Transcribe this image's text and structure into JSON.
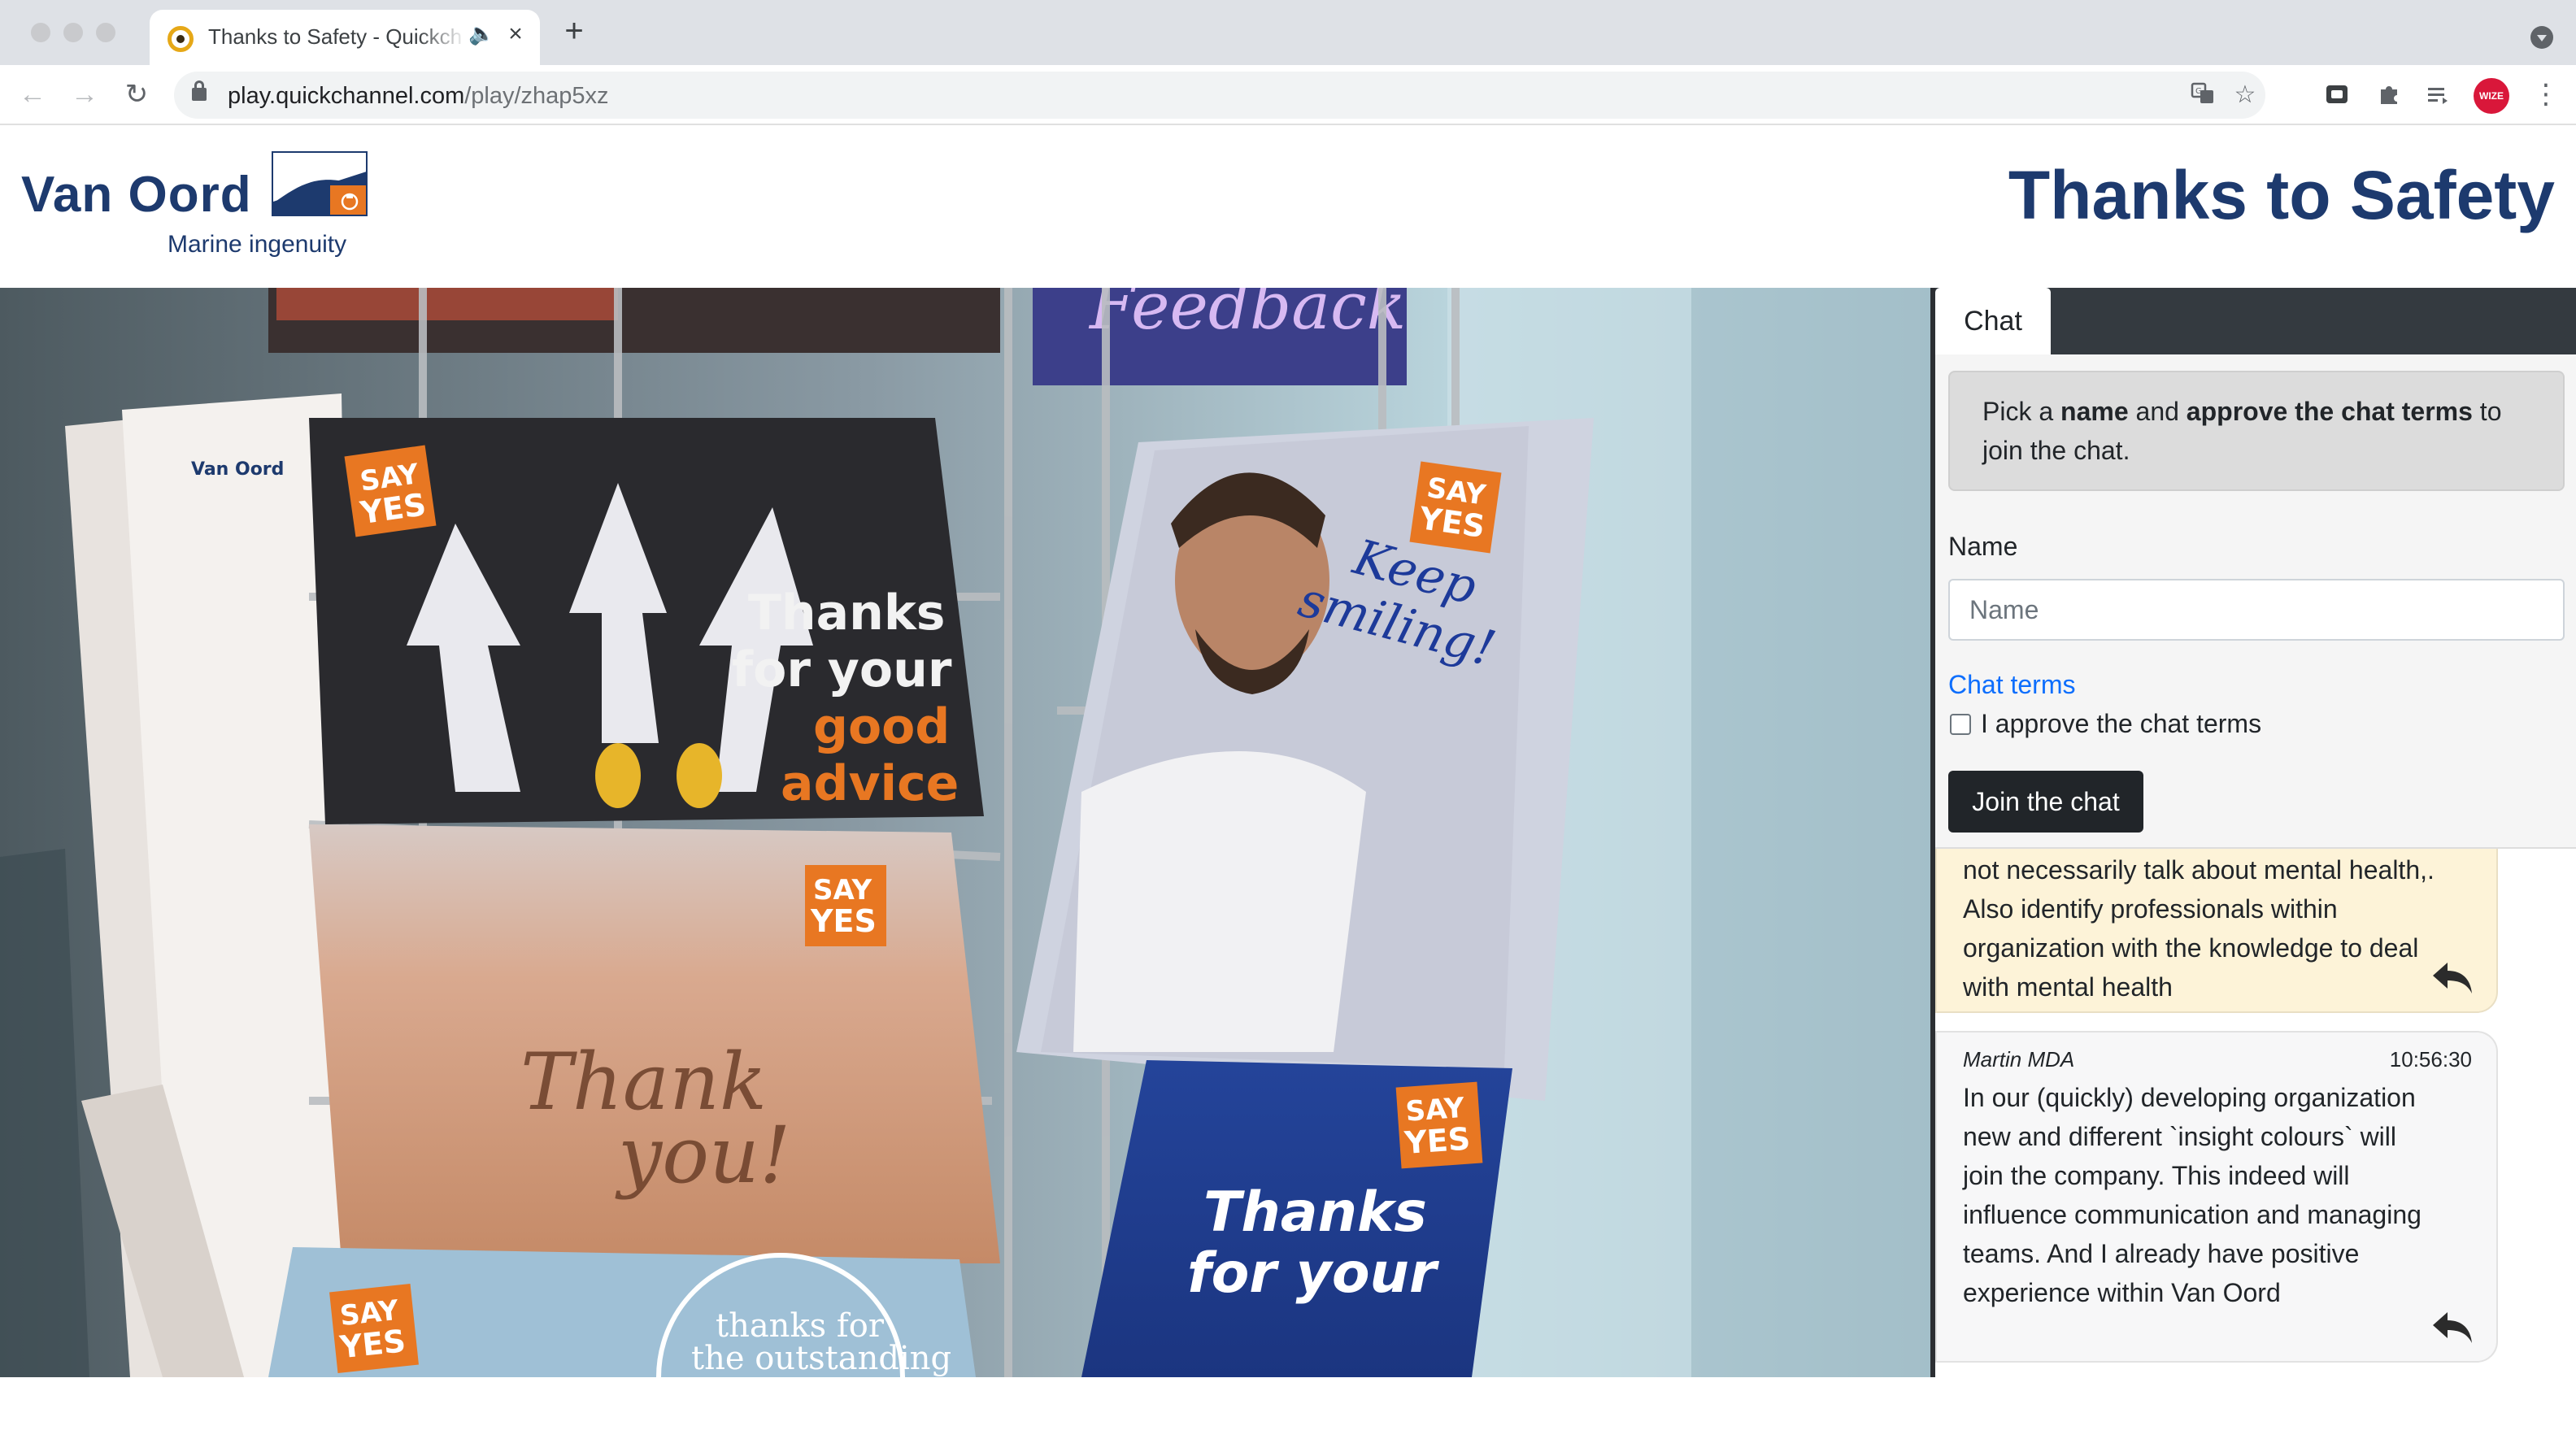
{
  "browser": {
    "tab": {
      "title": "Thanks to Safety - Quickchannel",
      "close": "×"
    },
    "new_tab": "+",
    "url": {
      "host": "play.quickchannel.com",
      "path": "/play/zhap5xz"
    },
    "nav": {
      "back": "←",
      "forward": "→",
      "reload": "↻"
    },
    "profile_label": "WIZE",
    "menu": "⋮"
  },
  "header": {
    "brand_name": "Van Oord",
    "brand_tagline": "Marine ingenuity",
    "title": "Thanks to Safety"
  },
  "chat": {
    "tab_label": "Chat",
    "notice": {
      "part1": "Pick a ",
      "bold1": "name",
      "part2": " and ",
      "bold2": "approve the chat terms",
      "part3": " to join the chat."
    },
    "name_label": "Name",
    "name_placeholder": "Name",
    "name_value": "",
    "terms_link": "Chat terms",
    "terms_checkbox_label": "I approve the chat terms",
    "terms_checked": false,
    "join_button": "Join the chat",
    "messages": [
      {
        "author": "",
        "time": "",
        "text": "not necessarily talk about mental health,. Also identify professionals within organization with the knowledge to deal with mental health",
        "highlighted": true
      },
      {
        "author": "Martin MDA",
        "time": "10:56:30",
        "text": "In our (quickly) developing organization new and different `insight colours` will join the company. This indeed will influence communication and managing teams. And I already have positive experience within Van Oord",
        "highlighted": false
      }
    ]
  },
  "video": {
    "card_texts": [
      "SAY YES",
      "Thanks for your good advice",
      "Keep smiling!",
      "Thank you!",
      "Thanks for your",
      "thanks for the outstanding",
      "Feedback"
    ]
  },
  "colors": {
    "brand": "#1d3a6e",
    "accent_orange": "#e87722",
    "link": "#0d6efd",
    "chat_tabbar": "#343a40",
    "message_highlight": "#fdf3d8"
  },
  "icons": [
    "favicon-icon",
    "audio-icon",
    "lock-icon",
    "translate-icon",
    "bookmark-star-icon",
    "extension-icon",
    "puzzle-icon",
    "reading-list-icon",
    "reply-icon",
    "checkbox-icon"
  ]
}
